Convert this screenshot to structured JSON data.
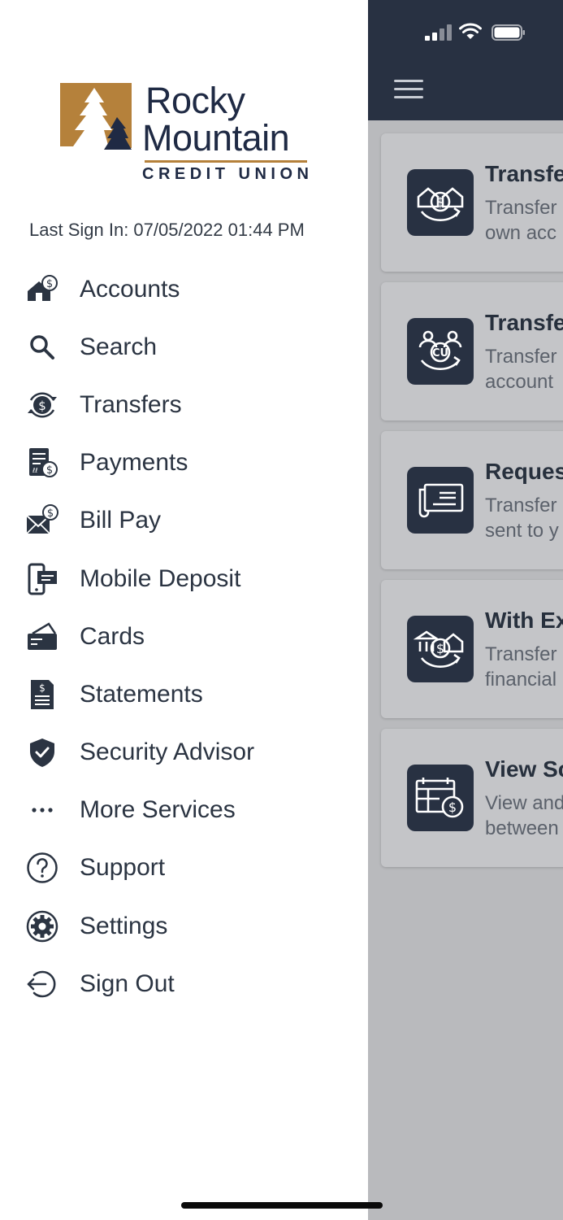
{
  "drawer": {
    "logo": {
      "line1": "Rocky",
      "line2": "Mountain",
      "line3": "CREDIT UNION"
    },
    "last_signin": "Last Sign In: 07/05/2022 01:44 PM",
    "menu": [
      {
        "label": "Accounts",
        "icon": "house-dollar-icon"
      },
      {
        "label": "Search",
        "icon": "search-icon"
      },
      {
        "label": "Transfers",
        "icon": "transfer-dollar-icon"
      },
      {
        "label": "Payments",
        "icon": "payments-icon"
      },
      {
        "label": "Bill Pay",
        "icon": "bill-pay-icon"
      },
      {
        "label": "Mobile Deposit",
        "icon": "mobile-deposit-icon"
      },
      {
        "label": "Cards",
        "icon": "card-icon"
      },
      {
        "label": "Statements",
        "icon": "statement-icon"
      },
      {
        "label": "Security Advisor",
        "icon": "shield-check-icon"
      },
      {
        "label": "More Services",
        "icon": "more-dots-icon"
      },
      {
        "label": "Support",
        "icon": "question-icon"
      },
      {
        "label": "Settings",
        "icon": "gear-icon"
      },
      {
        "label": "Sign Out",
        "icon": "sign-out-icon"
      }
    ]
  },
  "cards": [
    {
      "title": "Transfe",
      "desc1": "Transfer",
      "desc2": "own acc",
      "icon": "house-transfer-icon"
    },
    {
      "title": "Transfe",
      "desc1": "Transfer",
      "desc2": "account",
      "icon": "member-transfer-icon"
    },
    {
      "title": "Reques",
      "desc1": "Transfer",
      "desc2": "sent to y",
      "icon": "check-request-icon"
    },
    {
      "title": "With Ex",
      "desc1": "Transfer",
      "desc2": "financial",
      "icon": "external-transfer-icon"
    },
    {
      "title": "View Sc",
      "desc1": "View and",
      "desc2": "between",
      "icon": "calendar-dollar-icon"
    }
  ],
  "colors": {
    "navy": "#283142",
    "gold": "#b5813b",
    "text": "#2b3442",
    "overlay": "#b9babd"
  }
}
